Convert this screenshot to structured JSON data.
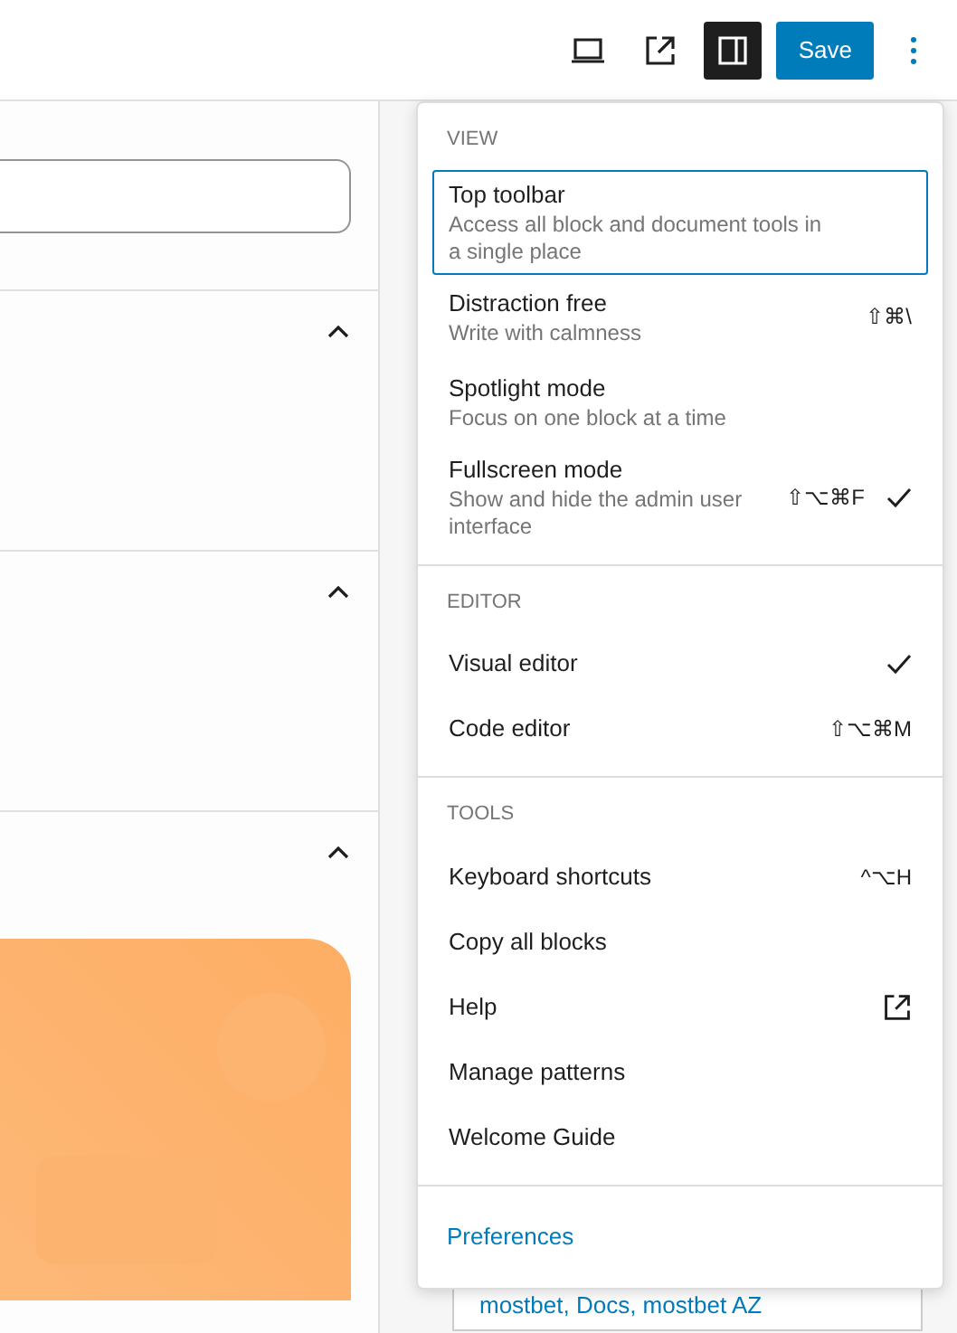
{
  "toolbar": {
    "save": "Save",
    "sidebar_toggle": {
      "on": true
    }
  },
  "panel": {
    "sections": [
      {
        "expanded": true
      },
      {
        "expanded": true
      },
      {
        "expanded": true
      }
    ]
  },
  "menu": {
    "groups": [
      {
        "label": "VIEW",
        "items": [
          {
            "label": "Top toolbar",
            "description": "Access all block and document tools in a single place",
            "checked": false,
            "focused": true
          },
          {
            "label": "Distraction free",
            "description": "Write with calmness",
            "shortcut": "⇧⌘\\",
            "checked": false,
            "focused": false
          },
          {
            "label": "Spotlight mode",
            "description": "Focus on one block at a time",
            "checked": false,
            "focused": false
          },
          {
            "label": "Fullscreen mode",
            "description": "Show and hide the admin user interface",
            "shortcut": "⇧⌥⌘F",
            "checked": true,
            "focused": false
          }
        ]
      },
      {
        "label": "EDITOR",
        "items": [
          {
            "label": "Visual editor",
            "checked": true
          },
          {
            "label": "Code editor",
            "shortcut": "⇧⌥⌘M",
            "checked": false
          }
        ]
      },
      {
        "label": "TOOLS",
        "items": [
          {
            "label": "Keyboard shortcuts",
            "shortcut": "^⌥H",
            "kind": "command"
          },
          {
            "label": "Copy all blocks",
            "kind": "command"
          },
          {
            "label": "Help",
            "kind": "external"
          },
          {
            "label": "Manage patterns",
            "kind": "command"
          },
          {
            "label": "Welcome Guide",
            "kind": "command"
          }
        ]
      }
    ],
    "footer": "Preferences"
  },
  "behind_text": "mostbet, Docs, mostbet AZ"
}
